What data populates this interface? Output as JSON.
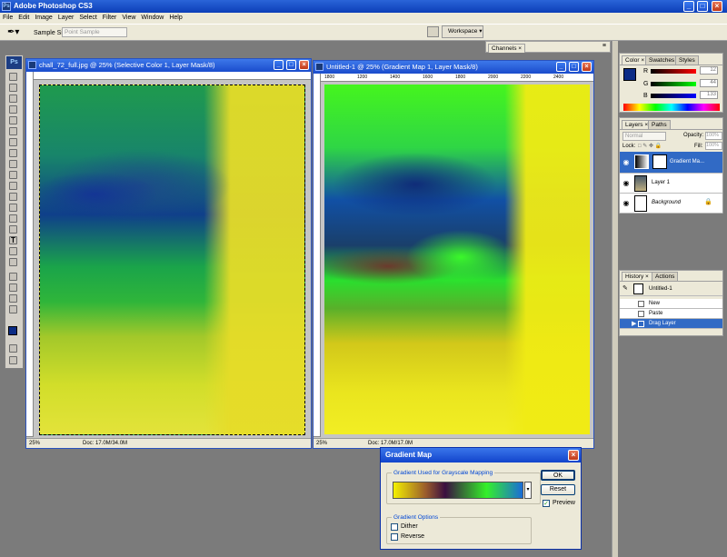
{
  "app": {
    "title": "Adobe Photoshop CS3",
    "logo": "Ps"
  },
  "menu": [
    "File",
    "Edit",
    "Image",
    "Layer",
    "Select",
    "Filter",
    "View",
    "Window",
    "Help"
  ],
  "options": {
    "sample_size_label": "Sample Size:",
    "sample_size_value": "Point Sample",
    "workspace_label": "Workspace"
  },
  "channels_tab": "Channels",
  "documents": [
    {
      "title": "chall_72_full.jpg @ 25% (Selective Color 1, Layer Mask/8)",
      "zoom": "25%",
      "doc": "Doc: 17.0M/34.0M"
    },
    {
      "title": "Untitled-1 @ 25% (Gradient Map 1, Layer Mask/8)",
      "zoom": "25%",
      "doc": "Doc: 17.0M/17.0M"
    }
  ],
  "ruler_ticks": [
    "1800",
    "1200",
    "1400",
    "1600",
    "1800",
    "2000",
    "2200",
    "2400"
  ],
  "color_panel": {
    "tabs": [
      "Color",
      "Swatches",
      "Styles"
    ],
    "channels": [
      {
        "label": "R",
        "value": "12"
      },
      {
        "label": "G",
        "value": "44"
      },
      {
        "label": "B",
        "value": "133"
      }
    ],
    "fg_color": "#0c2c85"
  },
  "layers_panel": {
    "tabs": [
      "Layers",
      "Paths"
    ],
    "blend_mode": "Normal",
    "opacity_label": "Opacity:",
    "opacity_value": "100%",
    "lock_label": "Lock:",
    "fill_label": "Fill:",
    "fill_value": "100%",
    "layers": [
      {
        "name": "Gradient Ma..."
      },
      {
        "name": "Layer 1"
      },
      {
        "name": "Background"
      }
    ]
  },
  "history_panel": {
    "tabs": [
      "History",
      "Actions"
    ],
    "snapshot": "Untitled-1",
    "items": [
      "New",
      "Paste",
      "Drag Layer"
    ]
  },
  "dialog": {
    "title": "Gradient Map",
    "group_label": "Gradient Used for Grayscale Mapping",
    "options_label": "Gradient Options",
    "dither_label": "Dither",
    "reverse_label": "Reverse",
    "ok_label": "OK",
    "reset_label": "Reset",
    "preview_label": "Preview",
    "preview_checked": true,
    "gradient_colors": [
      "#f4f000",
      "#9a5c2c",
      "#3a0f40",
      "#35f02a",
      "#1a6cd8"
    ]
  }
}
